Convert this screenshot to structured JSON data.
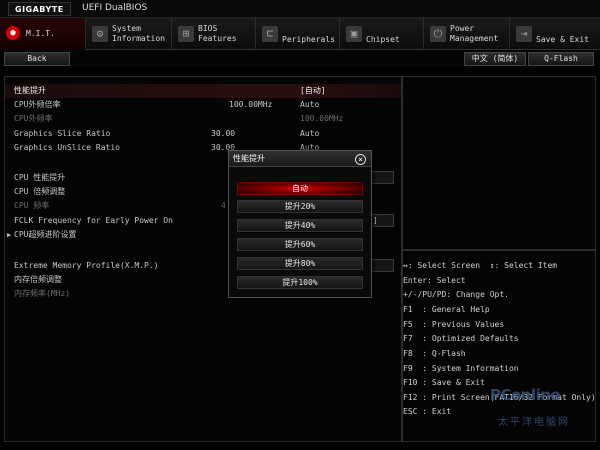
{
  "titlebar": {
    "brand": "GIGABYTE",
    "bios_name": "UEFI DualBIOS"
  },
  "tabs": [
    {
      "label": "M.I.T.",
      "icon": "mit-icon",
      "active": true
    },
    {
      "label": "System\nInformation",
      "icon": "gear-icon"
    },
    {
      "label": "BIOS\nFeatures",
      "icon": "bios-features-icon"
    },
    {
      "label": "Peripherals",
      "icon": "peripherals-icon"
    },
    {
      "label": "Chipset",
      "icon": "chipset-icon"
    },
    {
      "label": "Power\nManagement",
      "icon": "power-icon"
    },
    {
      "label": "Save & Exit",
      "icon": "save-exit-icon"
    }
  ],
  "subbar": {
    "back": "Back",
    "language": "中文 (简体)",
    "qflash": "Q-Flash"
  },
  "settings": [
    {
      "label": "性能提升",
      "value": "[自动]"
    },
    {
      "label": "CPU外频倍率",
      "mid": "100.00MHz",
      "value": "Auto"
    },
    {
      "label": "CPU外频率",
      "value": "100.00MHz"
    },
    {
      "label": "Graphics Slice Ratio",
      "mid": "30.00",
      "value": "Auto"
    },
    {
      "label": "Graphics UnSlice Ratio",
      "mid": "30.00",
      "value": "Auto"
    },
    {
      "label": "CPU 性能提升"
    },
    {
      "label": "CPU 倍频调整"
    },
    {
      "label": "CPU 频率",
      "mid": "4"
    },
    {
      "label": "FCLK Frequency for Early Power On",
      "value": "]"
    },
    {
      "label": "CPU超频进阶设置"
    },
    {
      "label": "Extreme Memory Profile(X.M.P.)"
    },
    {
      "label": "内存倍频调整"
    },
    {
      "label": "内存频率(MHz)"
    }
  ],
  "help": [
    "↔: Select Screen  ↕: Select Item",
    "Enter: Select",
    "+/-/PU/PD: Change Opt.",
    "F1  : General Help",
    "F5  : Previous Values",
    "F7  : Optimized Defaults",
    "F8  : Q-Flash",
    "F9  : System Information",
    "F10 : Save & Exit",
    "F12 : Print Screen(FAT16/32 Format Only)",
    "ESC : Exit"
  ],
  "popup": {
    "title": "性能提升",
    "close": "×",
    "options": [
      "自动",
      "提升20%",
      "提升40%",
      "提升60%",
      "提升80%",
      "提升100%"
    ],
    "selected_index": 0
  },
  "watermark": {
    "brand": "PConline",
    "sub": "太平洋电脑网"
  },
  "colors": {
    "accent": "#d40000",
    "highlight": "#2b0f0f",
    "text": "#c8c8c8",
    "dim": "#6c6c6c"
  }
}
